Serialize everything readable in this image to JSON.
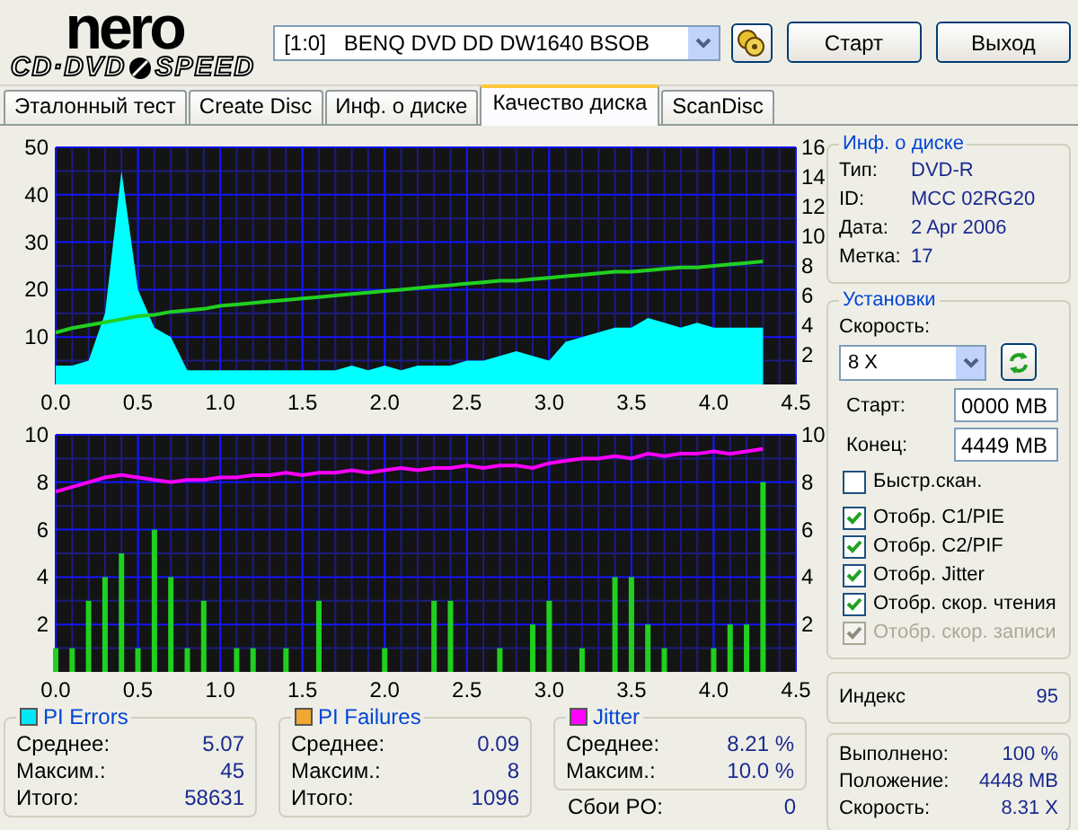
{
  "header": {
    "logo_top": "nero",
    "logo_bottom": [
      "CD·DVD",
      "SPEED"
    ],
    "drive": "[1:0]   BENQ DVD DD DW1640 BSOB",
    "buttons": [
      "Старт",
      "Выход"
    ]
  },
  "tabs": [
    {
      "label": "Эталонный тест",
      "selected": false
    },
    {
      "label": "Create Disc",
      "selected": false
    },
    {
      "label": "Инф. о диске",
      "selected": false
    },
    {
      "label": "Качество диска",
      "selected": true
    },
    {
      "label": "ScanDisc",
      "selected": false
    }
  ],
  "charts": [
    {
      "layers": [
        {
          "chart_data": {
            "type": "area",
            "grid": true,
            "xlim": [
              0,
              4.5
            ],
            "ylim": [
              0,
              50
            ],
            "xticks": [
              {
                "value": 0,
                "label": "0.0"
              },
              {
                "value": 0.5,
                "label": "0.5"
              },
              {
                "value": 1,
                "label": "1.0"
              },
              {
                "value": 1.5,
                "label": "1.5"
              },
              {
                "value": 2,
                "label": "2.0"
              },
              {
                "value": 2.5,
                "label": "2.5"
              },
              {
                "value": 3,
                "label": "3.0"
              },
              {
                "value": 3.5,
                "label": "3.5"
              },
              {
                "value": 4,
                "label": "4.0"
              },
              {
                "value": 4.5,
                "label": "4.5"
              }
            ],
            "yticks": [
              10,
              20,
              30,
              40,
              50
            ],
            "x": [
              0,
              0.1,
              0.2,
              0.3,
              0.4,
              0.5,
              0.6,
              0.7,
              0.8,
              0.9,
              1,
              1.1,
              1.2,
              1.3,
              1.4,
              1.5,
              1.6,
              1.7,
              1.8,
              1.9,
              2,
              2.1,
              2.2,
              2.3,
              2.4,
              2.5,
              2.6,
              2.7,
              2.8,
              2.9,
              3,
              3.1,
              3.2,
              3.3,
              3.4,
              3.5,
              3.6,
              3.7,
              3.8,
              3.9,
              4,
              4.1,
              4.2,
              4.3
            ],
            "series": [
              {
                "color": "#00ffff",
                "values": [
                  4,
                  4,
                  5,
                  15,
                  45,
                  20,
                  12,
                  10,
                  3,
                  3,
                  3,
                  3,
                  3,
                  3,
                  3,
                  3,
                  3,
                  3,
                  4,
                  3,
                  4,
                  3,
                  4,
                  4,
                  4,
                  5,
                  5,
                  6,
                  7,
                  6,
                  5,
                  9,
                  10,
                  11,
                  12,
                  12,
                  14,
                  13,
                  12,
                  13,
                  12,
                  12,
                  12,
                  12
                ]
              }
            ]
          }
        },
        {
          "chart_data": {
            "type": "line",
            "xlim": [
              0,
              4.5
            ],
            "ylim": [
              0,
              16
            ],
            "yticks": [
              2,
              4,
              6,
              8,
              10,
              12,
              14,
              16
            ],
            "x": [
              0,
              0.1,
              0.2,
              0.3,
              0.4,
              0.5,
              0.6,
              0.7,
              0.8,
              0.9,
              1,
              1.1,
              1.2,
              1.3,
              1.4,
              1.5,
              1.6,
              1.7,
              1.8,
              1.9,
              2,
              2.1,
              2.2,
              2.3,
              2.4,
              2.5,
              2.6,
              2.7,
              2.8,
              2.9,
              3,
              3.1,
              3.2,
              3.3,
              3.4,
              3.5,
              3.6,
              3.7,
              3.8,
              3.9,
              4,
              4.1,
              4.2,
              4.3
            ],
            "series": [
              {
                "color": "#20d020",
                "values": [
                  3.5,
                  3.8,
                  4.0,
                  4.2,
                  4.4,
                  4.6,
                  4.7,
                  4.9,
                  5.0,
                  5.1,
                  5.3,
                  5.4,
                  5.5,
                  5.6,
                  5.7,
                  5.8,
                  5.9,
                  6.0,
                  6.1,
                  6.2,
                  6.3,
                  6.4,
                  6.5,
                  6.6,
                  6.7,
                  6.8,
                  6.9,
                  7.0,
                  7.0,
                  7.1,
                  7.2,
                  7.3,
                  7.4,
                  7.5,
                  7.6,
                  7.6,
                  7.7,
                  7.8,
                  7.9,
                  7.9,
                  8.0,
                  8.1,
                  8.2,
                  8.3
                ]
              }
            ]
          }
        }
      ]
    },
    {
      "layers": [
        {
          "chart_data": {
            "type": "bar",
            "grid": true,
            "xlim": [
              0,
              4.5
            ],
            "ylim": [
              0,
              10
            ],
            "xticks": [
              {
                "value": 0,
                "label": "0.0"
              },
              {
                "value": 0.5,
                "label": "0.5"
              },
              {
                "value": 1,
                "label": "1.0"
              },
              {
                "value": 1.5,
                "label": "1.5"
              },
              {
                "value": 2,
                "label": "2.0"
              },
              {
                "value": 2.5,
                "label": "2.5"
              },
              {
                "value": 3,
                "label": "3.0"
              },
              {
                "value": 3.5,
                "label": "3.5"
              },
              {
                "value": 4,
                "label": "4.0"
              },
              {
                "value": 4.5,
                "label": "4.5"
              }
            ],
            "yticks": [
              2,
              4,
              6,
              8,
              10
            ],
            "x": [
              0,
              0.1,
              0.2,
              0.3,
              0.4,
              0.5,
              0.6,
              0.7,
              0.8,
              0.9,
              1,
              1.1,
              1.2,
              1.3,
              1.4,
              1.5,
              1.6,
              1.7,
              1.8,
              1.9,
              2,
              2.1,
              2.2,
              2.3,
              2.4,
              2.5,
              2.6,
              2.7,
              2.8,
              2.9,
              3,
              3.1,
              3.2,
              3.3,
              3.4,
              3.5,
              3.6,
              3.7,
              3.8,
              3.9,
              4,
              4.1,
              4.2,
              4.3
            ],
            "series": [
              {
                "color": "#20d020",
                "values": [
                  1,
                  1,
                  3,
                  4,
                  5,
                  1,
                  6,
                  4,
                  1,
                  3,
                  0,
                  1,
                  1,
                  0,
                  1,
                  0,
                  3,
                  0,
                  0,
                  0,
                  1,
                  0,
                  0,
                  3,
                  3,
                  0,
                  0,
                  1,
                  0,
                  2,
                  3,
                  0,
                  1,
                  0,
                  4,
                  4,
                  2,
                  1,
                  0,
                  0,
                  1,
                  2,
                  2,
                  8
                ]
              }
            ]
          }
        },
        {
          "chart_data": {
            "type": "line",
            "xlim": [
              0,
              4.5
            ],
            "ylim": [
              0,
              10
            ],
            "yticks": [
              2,
              4,
              6,
              8,
              10
            ],
            "x": [
              0,
              0.1,
              0.2,
              0.3,
              0.4,
              0.5,
              0.6,
              0.7,
              0.8,
              0.9,
              1,
              1.1,
              1.2,
              1.3,
              1.4,
              1.5,
              1.6,
              1.7,
              1.8,
              1.9,
              2,
              2.1,
              2.2,
              2.3,
              2.4,
              2.5,
              2.6,
              2.7,
              2.8,
              2.9,
              3,
              3.1,
              3.2,
              3.3,
              3.4,
              3.5,
              3.6,
              3.7,
              3.8,
              3.9,
              4,
              4.1,
              4.2,
              4.3
            ],
            "series": [
              {
                "color": "#ff00ff",
                "values": [
                  7.6,
                  7.8,
                  8.0,
                  8.2,
                  8.3,
                  8.2,
                  8.1,
                  8.0,
                  8.1,
                  8.1,
                  8.2,
                  8.2,
                  8.3,
                  8.3,
                  8.4,
                  8.3,
                  8.4,
                  8.4,
                  8.5,
                  8.4,
                  8.5,
                  8.6,
                  8.5,
                  8.6,
                  8.6,
                  8.7,
                  8.6,
                  8.7,
                  8.7,
                  8.6,
                  8.8,
                  8.9,
                  9.0,
                  9.0,
                  9.1,
                  9.0,
                  9.2,
                  9.1,
                  9.2,
                  9.2,
                  9.3,
                  9.2,
                  9.3,
                  9.4
                ]
              }
            ]
          }
        }
      ]
    }
  ],
  "stats": [
    {
      "title": "PI Errors",
      "color": "#00e8f8",
      "rows": [
        {
          "label": "Среднее:",
          "value": "5.07"
        },
        {
          "label": "Максим.:",
          "value": "45"
        },
        {
          "label": "Итого:",
          "value": "58631"
        }
      ]
    },
    {
      "title": "PI Failures",
      "color": "#f0a830",
      "rows": [
        {
          "label": "Среднее:",
          "value": "0.09"
        },
        {
          "label": "Максим.:",
          "value": "8"
        },
        {
          "label": "Итого:",
          "value": "1096"
        }
      ]
    },
    {
      "title": "Jitter",
      "color": "#ff00ff",
      "rows": [
        {
          "label": "Среднее:",
          "value": "8.21 %"
        },
        {
          "label": "Максим.:",
          "value": "10.0 %"
        }
      ]
    }
  ],
  "po_failures": {
    "label": "Сбои PO:",
    "value": "0"
  },
  "disc_info": {
    "title": "Инф. о диске",
    "rows": [
      {
        "label": "Тип:",
        "value": "DVD-R"
      },
      {
        "label": "ID:",
        "value": "MCC 02RG20"
      },
      {
        "label": "Дата:",
        "value": "2 Apr 2006"
      },
      {
        "label": "Метка:",
        "value": "17"
      }
    ]
  },
  "settings": {
    "title": "Установки",
    "speed_label": "Скорость:",
    "speed": "8 X",
    "start_label": "Старт:",
    "start": "0000 MB",
    "end_label": "Конец:",
    "end": "4449 MB",
    "options": [
      {
        "label": "Быстр.скан.",
        "checked": false,
        "disabled": false
      },
      {
        "label": "Отобр. C1/PIE",
        "checked": true,
        "disabled": false
      },
      {
        "label": "Отобр. C2/PIF",
        "checked": true,
        "disabled": false
      },
      {
        "label": "Отобр. Jitter",
        "checked": true,
        "disabled": false
      },
      {
        "label": "Отобр. скор. чтения",
        "checked": true,
        "disabled": false
      },
      {
        "label": "Отобр. скор. записи",
        "checked": true,
        "disabled": true
      }
    ]
  },
  "index": {
    "label": "Индекс",
    "value": "95"
  },
  "progress": [
    {
      "label": "Выполнено:",
      "value": "100 %"
    },
    {
      "label": "Положение:",
      "value": "4448 MB"
    },
    {
      "label": "Скорость:",
      "value": "8.31 X"
    }
  ]
}
